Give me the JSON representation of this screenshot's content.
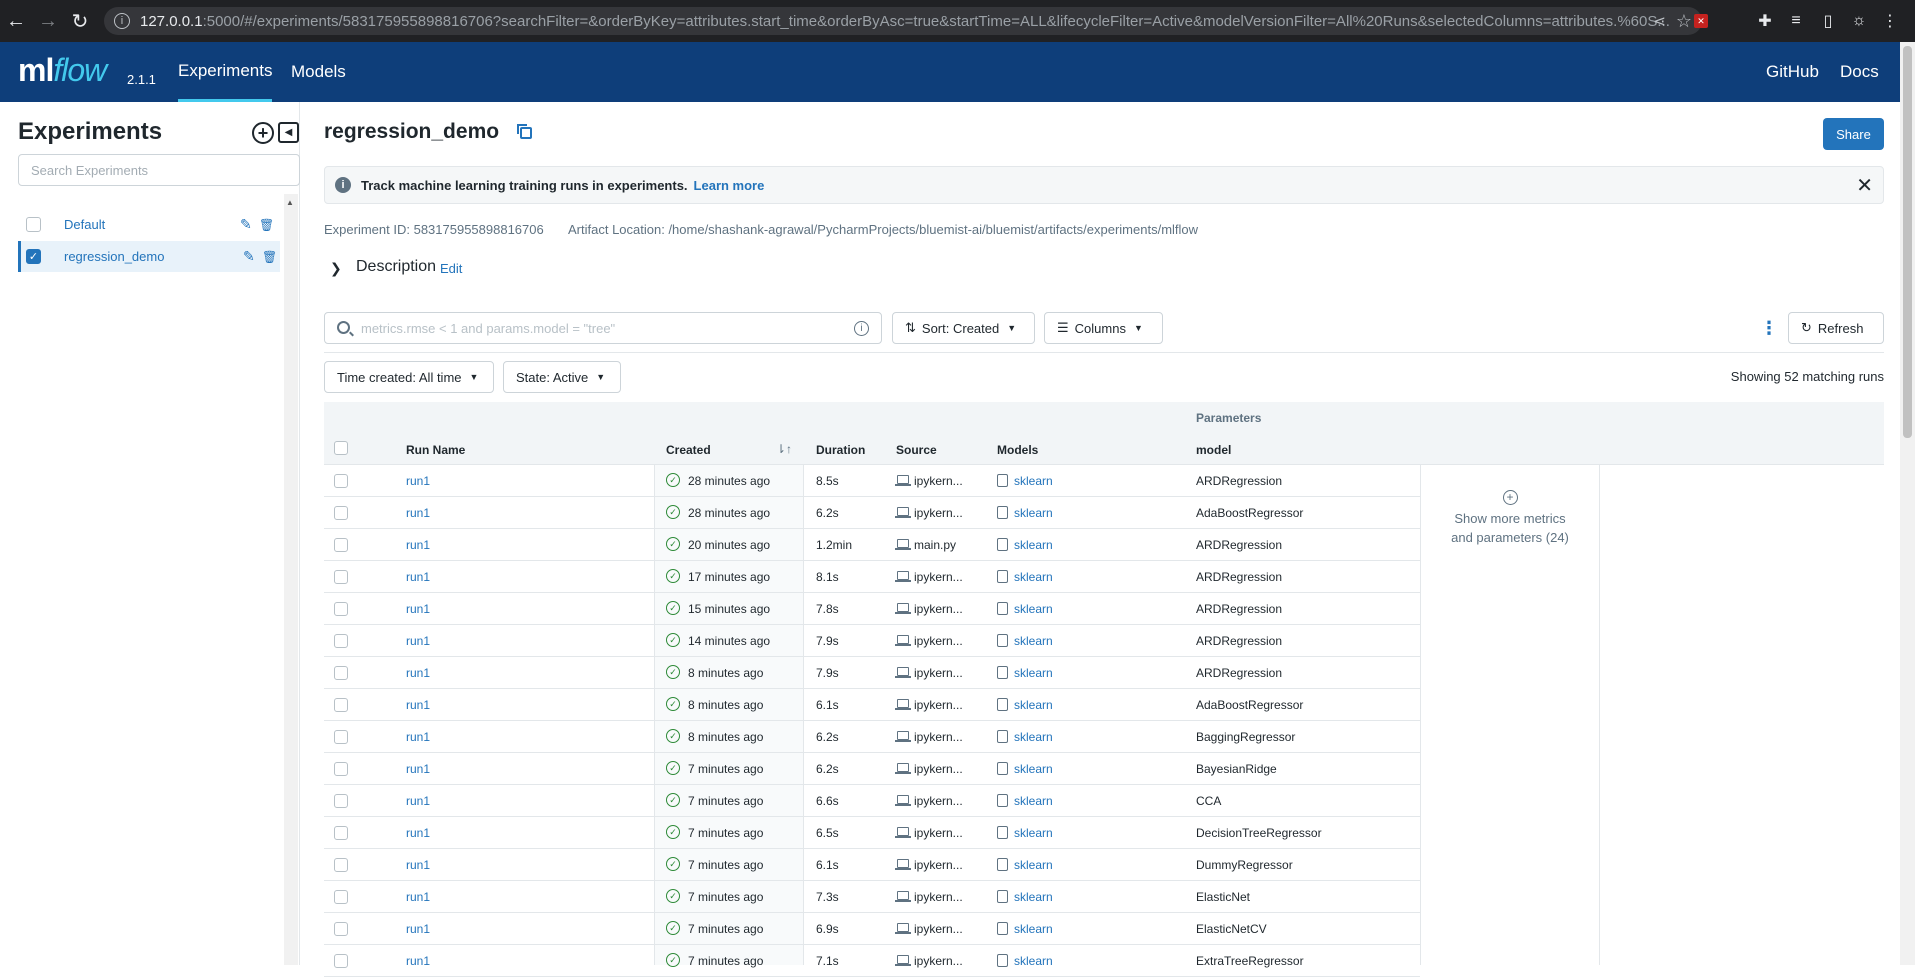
{
  "browser": {
    "url_host": "127.0.0.1",
    "url_rest": ":5000/#/experiments/583175955898816706?searchFilter=&orderByKey=attributes.start_time&orderByAsc=true&startTime=ALL&lifecycleFilter=Active&modelVersionFilter=All%20Runs&selectedColumns=attributes.%60S..."
  },
  "header": {
    "logo_ml": "ml",
    "logo_flow": "flow",
    "version": "2.1.1",
    "nav": [
      "Experiments",
      "Models"
    ],
    "right_links": [
      "GitHub",
      "Docs"
    ]
  },
  "sidebar": {
    "title": "Experiments",
    "search_placeholder": "Search Experiments",
    "items": [
      {
        "label": "Default",
        "checked": false
      },
      {
        "label": "regression_demo",
        "checked": true
      }
    ]
  },
  "main": {
    "title": "regression_demo",
    "share_label": "Share",
    "banner_text": "Track machine learning training runs in experiments.",
    "banner_link": "Learn more",
    "experiment_id": "Experiment ID: 583175955898816706",
    "artifact_location": "Artifact Location: /home/shashank-agrawal/PycharmProjects/bluemist-ai/bluemist/artifacts/experiments/mlflow",
    "description_label": "Description",
    "description_edit": "Edit",
    "search_placeholder": "metrics.rmse < 1 and params.model = \"tree\"",
    "sort_label": "Sort: Created",
    "columns_label": "Columns",
    "refresh_label": "Refresh",
    "time_filter": "Time created: All time",
    "state_filter": "State: Active",
    "showing": "Showing 52 matching runs"
  },
  "table": {
    "group_header": "Parameters",
    "columns": [
      "Run Name",
      "Created",
      "Duration",
      "Source",
      "Models",
      "model"
    ],
    "show_more_line1": "Show more metrics",
    "show_more_line2": "and parameters (24)",
    "rows": [
      {
        "run": "run1",
        "created": "28 minutes ago",
        "duration": "8.5s",
        "source": "ipykern...",
        "model": "sklearn",
        "param": "ARDRegression"
      },
      {
        "run": "run1",
        "created": "28 minutes ago",
        "duration": "6.2s",
        "source": "ipykern...",
        "model": "sklearn",
        "param": "AdaBoostRegressor"
      },
      {
        "run": "run1",
        "created": "20 minutes ago",
        "duration": "1.2min",
        "source": "main.py",
        "model": "sklearn",
        "param": "ARDRegression"
      },
      {
        "run": "run1",
        "created": "17 minutes ago",
        "duration": "8.1s",
        "source": "ipykern...",
        "model": "sklearn",
        "param": "ARDRegression"
      },
      {
        "run": "run1",
        "created": "15 minutes ago",
        "duration": "7.8s",
        "source": "ipykern...",
        "model": "sklearn",
        "param": "ARDRegression"
      },
      {
        "run": "run1",
        "created": "14 minutes ago",
        "duration": "7.9s",
        "source": "ipykern...",
        "model": "sklearn",
        "param": "ARDRegression"
      },
      {
        "run": "run1",
        "created": "8 minutes ago",
        "duration": "7.9s",
        "source": "ipykern...",
        "model": "sklearn",
        "param": "ARDRegression"
      },
      {
        "run": "run1",
        "created": "8 minutes ago",
        "duration": "6.1s",
        "source": "ipykern...",
        "model": "sklearn",
        "param": "AdaBoostRegressor"
      },
      {
        "run": "run1",
        "created": "8 minutes ago",
        "duration": "6.2s",
        "source": "ipykern...",
        "model": "sklearn",
        "param": "BaggingRegressor"
      },
      {
        "run": "run1",
        "created": "7 minutes ago",
        "duration": "6.2s",
        "source": "ipykern...",
        "model": "sklearn",
        "param": "BayesianRidge"
      },
      {
        "run": "run1",
        "created": "7 minutes ago",
        "duration": "6.6s",
        "source": "ipykern...",
        "model": "sklearn",
        "param": "CCA"
      },
      {
        "run": "run1",
        "created": "7 minutes ago",
        "duration": "6.5s",
        "source": "ipykern...",
        "model": "sklearn",
        "param": "DecisionTreeRegressor"
      },
      {
        "run": "run1",
        "created": "7 minutes ago",
        "duration": "6.1s",
        "source": "ipykern...",
        "model": "sklearn",
        "param": "DummyRegressor"
      },
      {
        "run": "run1",
        "created": "7 minutes ago",
        "duration": "7.3s",
        "source": "ipykern...",
        "model": "sklearn",
        "param": "ElasticNet"
      },
      {
        "run": "run1",
        "created": "7 minutes ago",
        "duration": "6.9s",
        "source": "ipykern...",
        "model": "sklearn",
        "param": "ElasticNetCV"
      },
      {
        "run": "run1",
        "created": "7 minutes ago",
        "duration": "7.1s",
        "source": "ipykern...",
        "model": "sklearn",
        "param": "ExtraTreeRegressor"
      }
    ]
  }
}
